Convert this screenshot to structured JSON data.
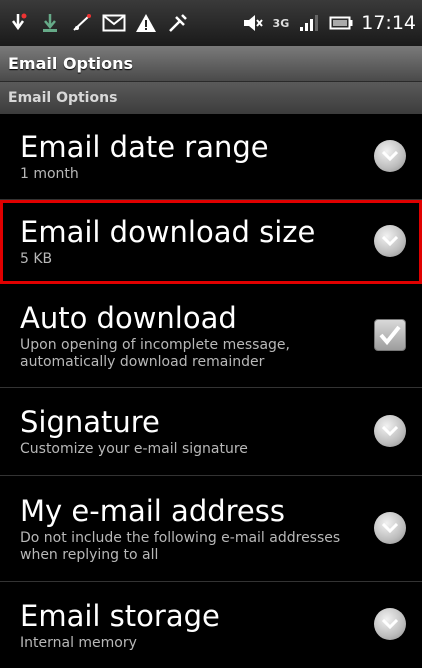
{
  "statusbar": {
    "icons": [
      "usb-debug-icon",
      "download-icon",
      "signal-missed-icon",
      "email-icon",
      "warning-icon",
      "tools-icon",
      "mute-icon",
      "3g-icon",
      "signal-bars-icon",
      "battery-icon"
    ],
    "network_label": "3G",
    "time": "17:14"
  },
  "window": {
    "title": "Email Options"
  },
  "section": {
    "header": "Email Options"
  },
  "colors": {
    "highlight": "#e00000",
    "titlebar": "#6a6a6a",
    "background": "#000000"
  },
  "settings": [
    {
      "title": "Email date range",
      "summary": "1 month",
      "widget": "dropdown"
    },
    {
      "title": "Email download size",
      "summary": "5 KB",
      "widget": "dropdown",
      "highlighted": true
    },
    {
      "title": "Auto download",
      "summary": "Upon opening of incomplete message, automatically download remainder",
      "widget": "checkbox",
      "checked": true
    },
    {
      "title": "Signature",
      "summary": "Customize your e-mail signature",
      "widget": "dropdown"
    },
    {
      "title": "My e-mail address",
      "summary": "Do not include the following e-mail addresses when replying to all",
      "widget": "dropdown"
    },
    {
      "title": "Email storage",
      "summary": "Internal memory",
      "widget": "dropdown"
    }
  ]
}
